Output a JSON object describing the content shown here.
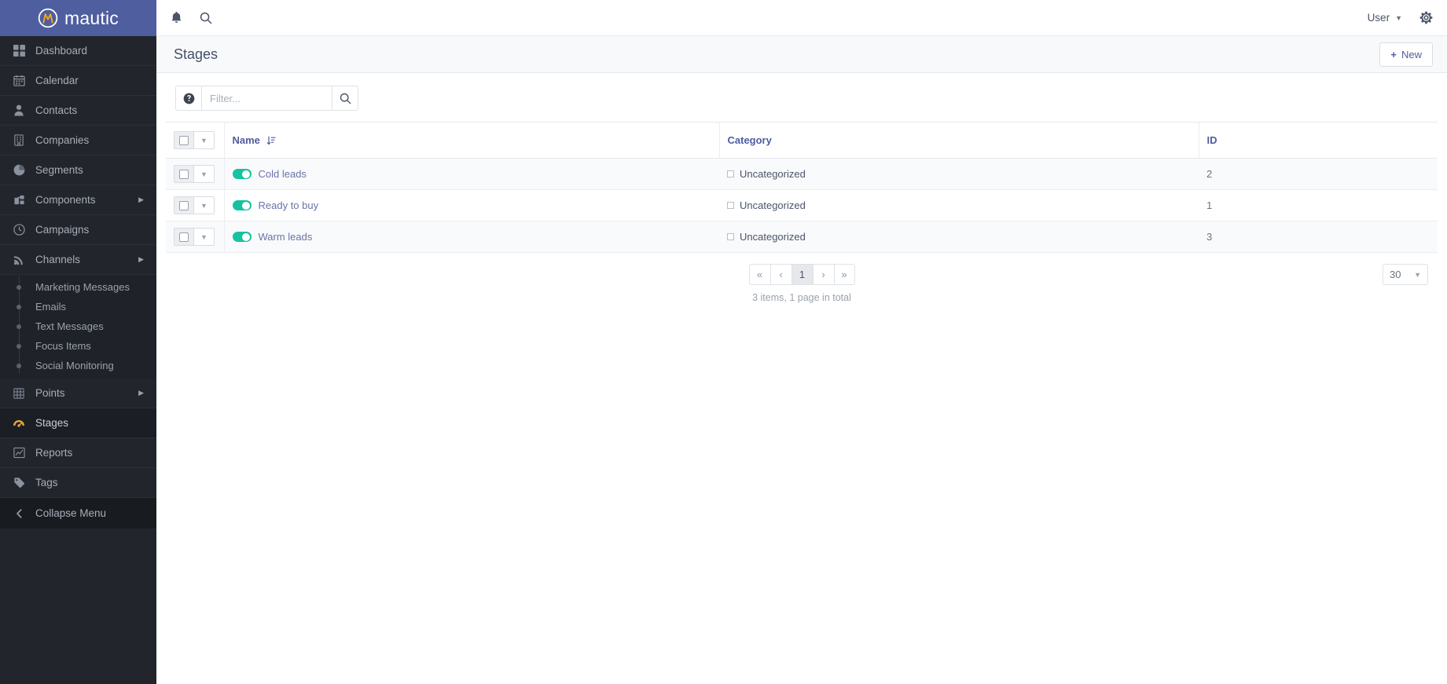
{
  "brand": {
    "name": "mautic",
    "logo_icon": "mautic-circle-m-logo"
  },
  "sidebar": {
    "items": [
      {
        "label": "Dashboard",
        "icon": "dashboard-grid-icon",
        "has_submenu": false,
        "active": false
      },
      {
        "label": "Calendar",
        "icon": "calendar-icon",
        "has_submenu": false,
        "active": false
      },
      {
        "label": "Contacts",
        "icon": "contacts-person-icon",
        "has_submenu": false,
        "active": false
      },
      {
        "label": "Companies",
        "icon": "companies-building-icon",
        "has_submenu": false,
        "active": false
      },
      {
        "label": "Segments",
        "icon": "segments-pie-icon",
        "has_submenu": false,
        "active": false
      },
      {
        "label": "Components",
        "icon": "components-puzzle-icon",
        "has_submenu": true,
        "active": false
      },
      {
        "label": "Campaigns",
        "icon": "campaigns-clock-icon",
        "has_submenu": false,
        "active": false
      },
      {
        "label": "Channels",
        "icon": "channels-rss-icon",
        "has_submenu": true,
        "active": false
      }
    ],
    "channels_submenu": [
      {
        "label": "Marketing Messages"
      },
      {
        "label": "Emails"
      },
      {
        "label": "Text Messages"
      },
      {
        "label": "Focus Items"
      },
      {
        "label": "Social Monitoring"
      }
    ],
    "items_lower": [
      {
        "label": "Points",
        "icon": "points-grid-icon",
        "has_submenu": true,
        "active": false
      },
      {
        "label": "Stages",
        "icon": "stages-gauge-icon",
        "has_submenu": false,
        "active": true
      },
      {
        "label": "Reports",
        "icon": "reports-chart-icon",
        "has_submenu": false,
        "active": false
      },
      {
        "label": "Tags",
        "icon": "tags-tag-icon",
        "has_submenu": false,
        "active": false
      }
    ],
    "collapse": {
      "label": "Collapse Menu",
      "icon": "chevron-left-icon"
    }
  },
  "topbar": {
    "notifications_icon": "bell-icon",
    "search_icon": "search-icon",
    "user_label": "User",
    "user_caret_icon": "caret-down-icon",
    "settings_icon": "gear-icon"
  },
  "page": {
    "title": "Stages",
    "new_button_label": "New",
    "new_button_icon": "plus-icon"
  },
  "toolbar": {
    "help_icon": "question-circle-icon",
    "filter_placeholder": "Filter...",
    "filter_value": "",
    "search_icon": "search-icon"
  },
  "table": {
    "columns": [
      {
        "key": "select",
        "label": ""
      },
      {
        "key": "name",
        "label": "Name",
        "sort_icon": "sort-ascending-icon",
        "sorted": true
      },
      {
        "key": "category",
        "label": "Category"
      },
      {
        "key": "id",
        "label": "ID"
      }
    ],
    "rows": [
      {
        "name": "Cold leads",
        "published": true,
        "category": "Uncategorized",
        "id": "2"
      },
      {
        "name": "Ready to buy",
        "published": true,
        "category": "Uncategorized",
        "id": "1"
      },
      {
        "name": "Warm leads",
        "published": true,
        "category": "Uncategorized",
        "id": "3"
      }
    ]
  },
  "pagination": {
    "first_label": "«",
    "prev_label": "‹",
    "current_page": "1",
    "next_label": "›",
    "last_label": "»",
    "summary": "3 items, 1 page in total",
    "page_size": "30"
  },
  "colors": {
    "brand_blue": "#4e5e9e",
    "sidebar_bg": "#22252c",
    "link_blue": "#6b74a8",
    "header_blue": "#4e5d9e",
    "toggle_green": "#17c2a0",
    "stages_icon_orange": "#e8a33d"
  }
}
